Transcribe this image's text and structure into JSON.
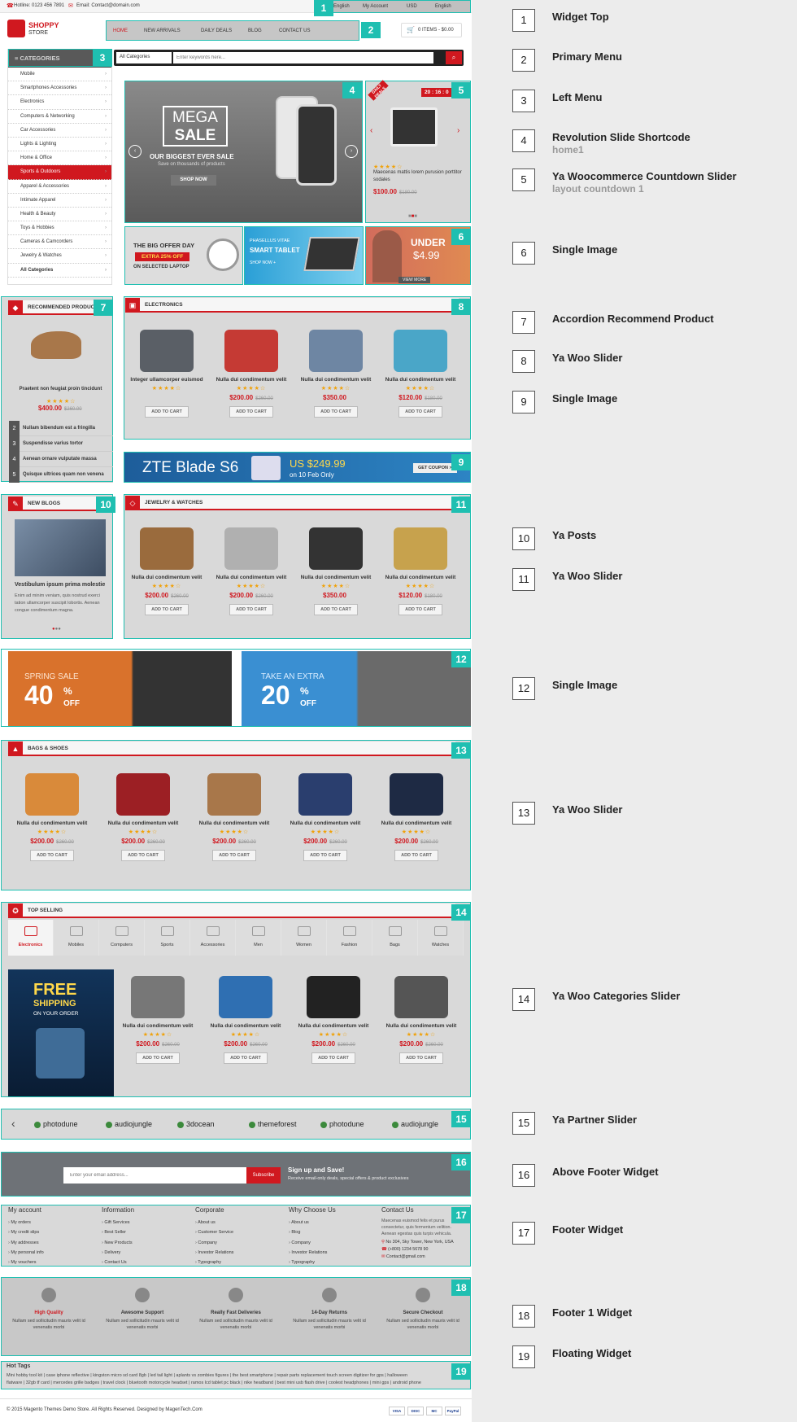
{
  "topbar": {
    "hotline": "Hotline: 0123 456 7891",
    "email": "Email: Contact@domain.com",
    "language_left": "English",
    "account": "My Account",
    "currency": "USD",
    "language": "English"
  },
  "logo": {
    "brand": "SHOPPY",
    "sub": "STORE"
  },
  "nav": {
    "items": [
      "HOME",
      "NEW ARRIVALS",
      "DAILY DEALS",
      "BLOG",
      "CONTACT US"
    ]
  },
  "cart": {
    "label": "0 ITEMS - $0.00"
  },
  "search": {
    "category": "All Categories",
    "placeholder": "Enter keywords here..."
  },
  "categories": {
    "title": "CATEGORIES",
    "items": [
      "Mobile",
      "Smartphones Accessories",
      "Electronics",
      "Computers & Networking",
      "Car Accessories",
      "Lights & Lighting",
      "Home & Office",
      "Sports & Outdoors",
      "Apparel & Accessories",
      "Intimate Apparel",
      "Health & Beauty",
      "Toys & Hobbies",
      "Cameras & Camcorders",
      "Jewelry & Watches",
      "All Categories"
    ],
    "active_index": 7
  },
  "hero": {
    "mega": "MEGA",
    "sale": "SALE",
    "tagline": "OUR BIGGEST EVER SALE",
    "subline": "Save on thousands of products",
    "button": "SHOP NOW"
  },
  "countdown": {
    "badge": "DAILY DEALS",
    "timer": "20 : 16 : 0",
    "product": "Maecenas mattis lorem purusion porttitor sodales",
    "price": "$100.00",
    "old_price": "$180.00"
  },
  "banners": {
    "laptop": {
      "line1": "THE BIG OFFER DAY",
      "line2": "EXTRA 25% OFF",
      "line3": "ON SELECTED LAPTOP"
    },
    "tablet": {
      "line1": "PHASELLUS VITAE",
      "line2": "SMART TABLET",
      "line3": "SHOP NOW +"
    },
    "under": {
      "line1": "UNDER",
      "line2": "$4.99",
      "line3": "VIEW MORE"
    }
  },
  "recommended": {
    "title": "RECOMMENDED PRODUCT",
    "product": "Praetent non feugiat proin tincidunt",
    "price": "$400.00",
    "old_price": "$260.00",
    "list": [
      {
        "num": "2",
        "name": "Nullam bibendum est a fringilla"
      },
      {
        "num": "3",
        "name": "Suspendisse varius tortor"
      },
      {
        "num": "4",
        "name": "Aenean ornare vulputate massa"
      },
      {
        "num": "5",
        "name": "Quisque ultrices quam non venena"
      }
    ]
  },
  "electronics": {
    "title": "ELECTRONICS",
    "products": [
      {
        "name": "Integer ullamcorper euismod",
        "price": "",
        "old": "",
        "btn": "ADD TO CART"
      },
      {
        "name": "Nulla dui condimentum velit",
        "price": "$200.00",
        "old": "$260.00",
        "btn": "ADD TO CART"
      },
      {
        "name": "Nulla dui condimentum velit",
        "price": "$350.00",
        "old": "",
        "btn": "ADD TO CART"
      },
      {
        "name": "Nulla dui condimentum velit",
        "price": "$120.00",
        "old": "$180.00",
        "btn": "ADD TO CART"
      }
    ]
  },
  "zte": {
    "brand": "ZTE Blade S6",
    "price": "US $249.99",
    "date": "on 10 Feb Only",
    "button": "GET COUPON >"
  },
  "blogs": {
    "title": "NEW BLOGS",
    "post_title": "Vestibulum ipsum prima molestie",
    "excerpt": "Enim ad minim veniam, quis nostrud exerci tation ullamcorper suscipit lobortis. Aenean congue condimentum magna."
  },
  "jewelry": {
    "title": "JEWELRY & WATCHES",
    "products": [
      {
        "name": "Nulla dui condimentum velit",
        "price": "$200.00",
        "old": "$260.00",
        "btn": "ADD TO CART"
      },
      {
        "name": "Nulla dui condimentum velit",
        "price": "$200.00",
        "old": "$260.00",
        "btn": "ADD TO CART"
      },
      {
        "name": "Nulla dui condimentum velit",
        "price": "$350.00",
        "old": "",
        "btn": "ADD TO CART"
      },
      {
        "name": "Nulla dui condimentum velit",
        "price": "$120.00",
        "old": "$180.00",
        "btn": "ADD TO CART"
      }
    ]
  },
  "sale_banners": {
    "spring": {
      "label": "SPRING SALE",
      "pct": "40",
      "off": "OFF"
    },
    "extra": {
      "label": "TAKE AN EXTRA",
      "pct": "20",
      "off": "OFF"
    }
  },
  "bags": {
    "title": "BAGS & SHOES",
    "products": [
      {
        "name": "Nulla dui condimentum velit",
        "price": "$200.00",
        "old": "$260.00",
        "btn": "ADD TO CART"
      },
      {
        "name": "Nulla dui condimentum velit",
        "price": "$200.00",
        "old": "$260.00",
        "btn": "ADD TO CART"
      },
      {
        "name": "Nulla dui condimentum velit",
        "price": "$200.00",
        "old": "$260.00",
        "btn": "ADD TO CART"
      },
      {
        "name": "Nulla dui condimentum velit",
        "price": "$200.00",
        "old": "$260.00",
        "btn": "ADD TO CART"
      },
      {
        "name": "Nulla dui condimentum velit",
        "price": "$200.00",
        "old": "$260.00",
        "btn": "ADD TO CART"
      }
    ]
  },
  "top_selling": {
    "title": "TOP SELLING",
    "cats": [
      "Electronics",
      "Mobiles",
      "Computers",
      "Sports",
      "Accessories",
      "Men",
      "Women",
      "Fashion",
      "Bags",
      "Watches"
    ],
    "promo": {
      "line1": "FREE",
      "line2": "SHIPPING",
      "line3": "ON YOUR ORDER"
    },
    "products": [
      {
        "name": "Nulla dui condimentum velit",
        "price": "$200.00",
        "old": "$260.00",
        "btn": "ADD TO CART"
      },
      {
        "name": "Nulla dui condimentum velit",
        "price": "$200.00",
        "old": "$260.00",
        "btn": "ADD TO CART"
      },
      {
        "name": "Nulla dui condimentum velit",
        "price": "$200.00",
        "old": "$260.00",
        "btn": "ADD TO CART"
      },
      {
        "name": "Nulla dui condimentum velit",
        "price": "$200.00",
        "old": "$260.00",
        "btn": "ADD TO CART"
      }
    ]
  },
  "partners": [
    "photodune",
    "audiojungle",
    "3docean",
    "themeforest",
    "photodune",
    "audiojungle"
  ],
  "newsletter": {
    "placeholder": "Enter your email address...",
    "button": "Subscribe",
    "title": "Sign up and Save!",
    "desc": "Receive email-only deals, special offers & product exclusives"
  },
  "footer": {
    "cols": [
      {
        "title": "My account",
        "links": [
          "My orders",
          "My credit slips",
          "My addresses",
          "My personal info",
          "My vouchers"
        ]
      },
      {
        "title": "Information",
        "links": [
          "Gift Services",
          "Best Seller",
          "New Products",
          "Delivery",
          "Contact Us"
        ]
      },
      {
        "title": "Corporate",
        "links": [
          "About us",
          "Customer Service",
          "Company",
          "Investor Relations",
          "Typography"
        ]
      },
      {
        "title": "Why Choose Us",
        "links": [
          "About us",
          "Blog",
          "Company",
          "Investor Relations",
          "Typography"
        ]
      }
    ],
    "contact": {
      "title": "Contact Us",
      "text": "Maecenas euismod felis et purus consectetur, quis fermentum velition. Aenean egestas quis turpis vehicula.",
      "address": "No 304, Sky Tower, New York, USA",
      "phone": "(+800) 1234 5678 90",
      "email": "Contact@gmail.com"
    }
  },
  "features": [
    {
      "title": "High Quality",
      "text": "Nullam sed sollicitudin mauris velit id venenatis morbi"
    },
    {
      "title": "Awesome Support",
      "text": "Nullam sed sollicitudin mauris velit id venenatis morbi"
    },
    {
      "title": "Really Fast Deliveries",
      "text": "Nullam sed sollicitudin mauris velit id venenatis morbi"
    },
    {
      "title": "14-Day Returns",
      "text": "Nullam sed sollicitudin mauris velit id venenatis morbi"
    },
    {
      "title": "Secure Checkout",
      "text": "Nullam sed sollicitudin mauris velit id venenatis morbi"
    }
  ],
  "hot_tags": {
    "title": "Hot Tags",
    "line1": "Mini hobby tool kit | case iphone reflective | kingston micro sd card 8gb | led tail light | aplants vs zombies figures | the best smartphone | repair parts replacement touch screen digitizer for gps | halloween",
    "line2": "flatware | 32gb tf card | mercedes grille badges | travel clock | bluetooth motorcycle headset | ramos lcd tablet pc black | nike headband | best mini usb flash drive | coolest headphones | mini gps | android phone"
  },
  "copyright": "© 2015 Magento Themes Demo Store. All Rights Reserved. Designed by MagenTech.Com",
  "payments": [
    "VISA",
    "DISC",
    "MC",
    "PayPal"
  ],
  "legend": [
    {
      "num": "1",
      "title": "Widget Top",
      "sub": ""
    },
    {
      "num": "2",
      "title": "Primary Menu",
      "sub": ""
    },
    {
      "num": "3",
      "title": "Left Menu",
      "sub": ""
    },
    {
      "num": "4",
      "title": "Revolution Slide Shortcode",
      "sub": "home1"
    },
    {
      "num": "5",
      "title": "Ya Woocommerce Countdown Slider",
      "sub": "layout countdown 1"
    },
    {
      "num": "6",
      "title": "Single Image",
      "sub": ""
    },
    {
      "num": "7",
      "title": "Accordion Recommend Product",
      "sub": ""
    },
    {
      "num": "8",
      "title": "Ya Woo Slider",
      "sub": ""
    },
    {
      "num": "9",
      "title": "Single Image",
      "sub": ""
    },
    {
      "num": "10",
      "title": "Ya Posts",
      "sub": ""
    },
    {
      "num": "11",
      "title": "Ya Woo Slider",
      "sub": ""
    },
    {
      "num": "12",
      "title": "Single Image",
      "sub": ""
    },
    {
      "num": "13",
      "title": "Ya Woo Slider",
      "sub": ""
    },
    {
      "num": "14",
      "title": "Ya Woo Categories Slider",
      "sub": ""
    },
    {
      "num": "15",
      "title": "Ya Partner Slider",
      "sub": ""
    },
    {
      "num": "16",
      "title": "Above Footer Widget",
      "sub": ""
    },
    {
      "num": "17",
      "title": "Footer Widget",
      "sub": ""
    },
    {
      "num": "18",
      "title": "Footer 1 Widget",
      "sub": ""
    },
    {
      "num": "19",
      "title": "Floating Widget",
      "sub": ""
    }
  ],
  "colors": {
    "accent": "#d0181f",
    "overlay_border": "#1fbfb1"
  }
}
